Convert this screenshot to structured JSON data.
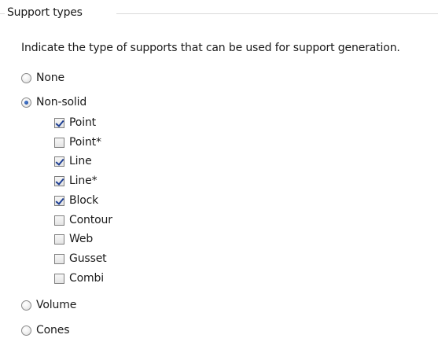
{
  "group": {
    "title": "Support types",
    "description": "Indicate the type of supports that can be used for support generation."
  },
  "radio_options": [
    {
      "label": "None",
      "selected": false
    },
    {
      "label": "Non-solid",
      "selected": true
    },
    {
      "label": "Volume",
      "selected": false
    },
    {
      "label": "Cones",
      "selected": false
    }
  ],
  "checkbox_options": [
    {
      "label": "Point",
      "checked": true
    },
    {
      "label": "Point*",
      "checked": false
    },
    {
      "label": "Line",
      "checked": true
    },
    {
      "label": "Line*",
      "checked": true
    },
    {
      "label": "Block",
      "checked": true
    },
    {
      "label": "Contour",
      "checked": false
    },
    {
      "label": "Web",
      "checked": false
    },
    {
      "label": "Gusset",
      "checked": false
    },
    {
      "label": "Combi",
      "checked": false
    }
  ]
}
